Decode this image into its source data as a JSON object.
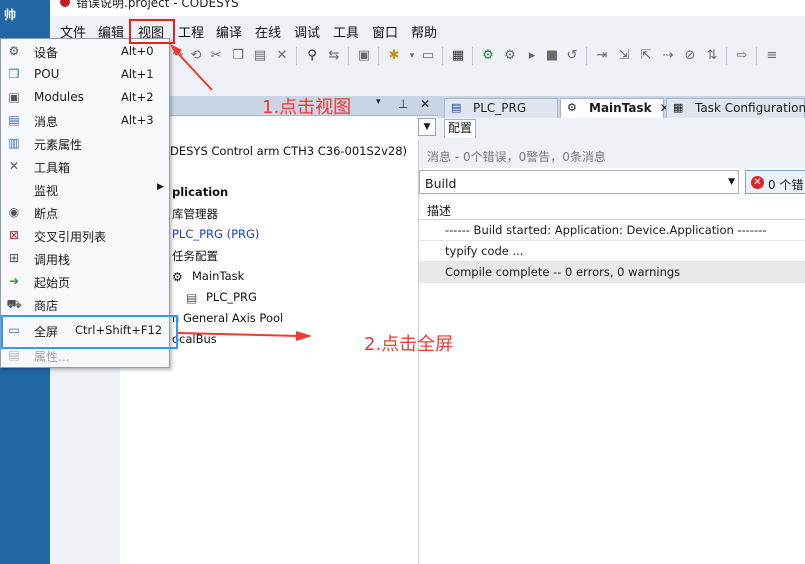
{
  "window": {
    "title": "错误说明.project - CODESYS"
  },
  "desktop": {
    "glyph": "帅"
  },
  "menubar": {
    "items": [
      "文件",
      "编辑",
      "视图",
      "工程",
      "编译",
      "在线",
      "调试",
      "工具",
      "窗口",
      "帮助"
    ]
  },
  "view_menu": {
    "items": [
      {
        "label": "设备",
        "shortcut": "Alt+0",
        "icon": "devices-icon"
      },
      {
        "label": "POU",
        "shortcut": "Alt+1",
        "icon": "pou-icon"
      },
      {
        "label": "Modules",
        "shortcut": "Alt+2",
        "icon": "modules-icon"
      },
      {
        "label": "消息",
        "shortcut": "Alt+3",
        "icon": "messages-icon"
      },
      {
        "label": "元素属性",
        "shortcut": "",
        "icon": "element-properties-icon"
      },
      {
        "label": "工具箱",
        "shortcut": "",
        "icon": "toolbox-icon"
      },
      {
        "label": "监视",
        "shortcut": "",
        "icon": "",
        "submenu": true
      },
      {
        "label": "断点",
        "shortcut": "",
        "icon": "breakpoints-icon"
      },
      {
        "label": "交叉引用列表",
        "shortcut": "",
        "icon": "cross-reference-icon"
      },
      {
        "label": "调用栈",
        "shortcut": "",
        "icon": "call-stack-icon"
      },
      {
        "label": "起始页",
        "shortcut": "",
        "icon": "start-page-icon"
      },
      {
        "label": "商店",
        "shortcut": "",
        "icon": "store-icon"
      },
      {
        "label": "全屏",
        "shortcut": "Ctrl+Shift+F12",
        "icon": "fullscreen-icon"
      },
      {
        "label": "属性...",
        "shortcut": "",
        "icon": "properties-icon",
        "disabled": true
      }
    ]
  },
  "device_tree": {
    "rows": [
      {
        "text": "DESYS Control arm CTH3 C36-001S2v28)",
        "icon": ""
      },
      {
        "text": "plication",
        "icon": ""
      },
      {
        "text": "库管理器",
        "icon": ""
      },
      {
        "text": "PLC_PRG (PRG)",
        "icon": ""
      },
      {
        "text": "任务配置",
        "icon": ""
      },
      {
        "text": "MainTask",
        "icon": "task-icon"
      },
      {
        "text": "PLC_PRG",
        "icon": "program-icon"
      },
      {
        "text": "n General Axis Pool",
        "icon": ""
      },
      {
        "text": "ocalBus",
        "icon": ""
      }
    ]
  },
  "editor_tabs": [
    {
      "label": "PLC_PRG",
      "icon": "program-icon",
      "active": false
    },
    {
      "label": "MainTask",
      "icon": "task-icon",
      "active": true,
      "close": "✕"
    },
    {
      "label": "Task Configuration",
      "icon": "task-config-icon",
      "active": false
    }
  ],
  "sub_tab": {
    "label": "配置"
  },
  "messages": {
    "summary": "消息 - 0个错误，0警告，0条消息",
    "category": "Build",
    "error_filter": "0 个错",
    "column": "描述",
    "rows": [
      "------ Build started: Application: Device.Application -------",
      "typify code ...",
      "Compile complete -- 0 errors, 0 warnings"
    ]
  },
  "annotations": {
    "step1": "1.点击视图",
    "step2": "2.点击全屏"
  },
  "colors": {
    "annotation": "#f03a2e",
    "menu_highlight": "#e8231f",
    "fullscreen_highlight": "#2e9cf0",
    "desktop": "#2166a5"
  }
}
